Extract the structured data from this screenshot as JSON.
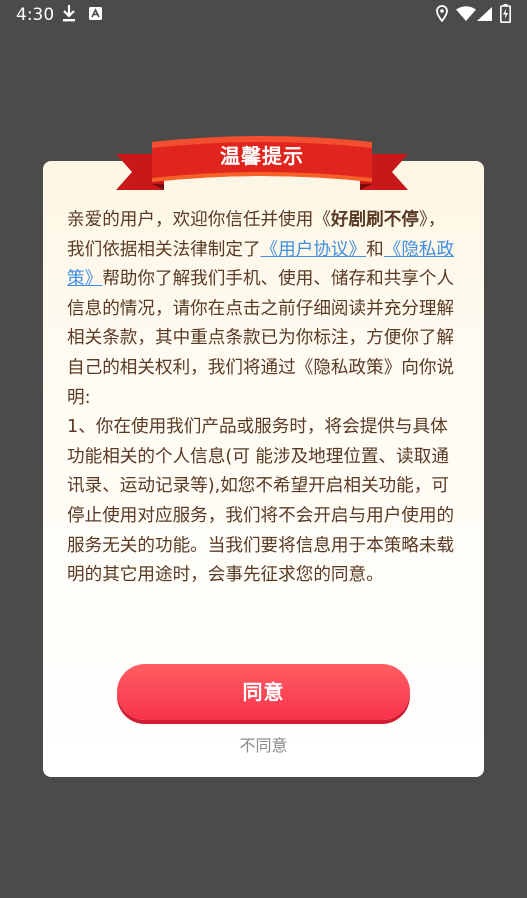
{
  "status_bar": {
    "time": "4:30"
  },
  "dialog": {
    "title": "温馨提示",
    "paragraph1": {
      "intro": "亲爱的用户，欢迎你信任并使用《",
      "app_name": "好剧刷不停",
      "after_app": "》，我们依据相关法律制定了",
      "link_user": "《用户协议》",
      "and": "和",
      "link_privacy": "《隐私政策》",
      "rest": "帮助你了解我们手机、使用、储存和共享个人信息的情况，请你在点击之前仔细阅读并充分理解相关条款，其中重点条款已为你标注，方便你了解自己的相关权利，我们将通过《隐私政策》向你说明:"
    },
    "paragraph2": " 1、你在使用我们产品或服务时，将会提供与具体功能相关的个人信息(可 能涉及地理位置、读取通讯录、运动记录等),如您不希望开启相关功能，可停止使用对应服务，我们将不会开启与用户使用的服务无关的功能。当我们要将信息用于本策略未载明的其它用途时，会事先征求您的同意。",
    "agree_label": "同意",
    "disagree_label": "不同意"
  },
  "colors": {
    "overlay": "#4d4b49",
    "ribbon_red": "#e0251f",
    "button_red": "#f7324a",
    "link_blue": "#3f8ee0",
    "text_brown": "#5a3a24"
  }
}
